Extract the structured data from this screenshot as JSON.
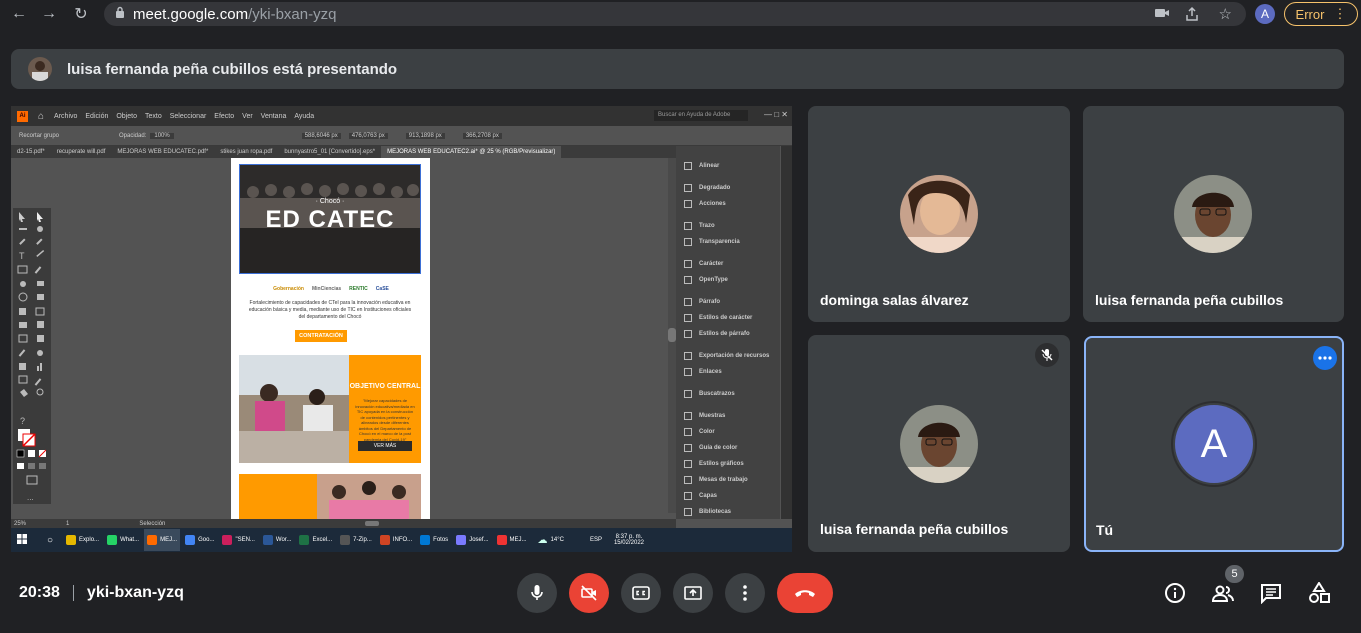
{
  "browser": {
    "url_host": "meet.google.com",
    "url_path": "/yki-bxan-yzq",
    "profile_initial": "A",
    "error_label": "Error"
  },
  "banner": {
    "text": "luisa fernanda peña cubillos está presentando"
  },
  "presentation": {
    "menu": [
      "Archivo",
      "Edición",
      "Objeto",
      "Texto",
      "Seleccionar",
      "Efecto",
      "Ver",
      "Ventana",
      "Ayuda"
    ],
    "search_placeholder": "Buscar en Ayuda de Adobe",
    "control_left": "Recortar grupo",
    "opacity_label": "Opacidad:",
    "opacity_value": "100%",
    "x_value": "588,6046 px",
    "y_value": "476,0763 px",
    "w_value": "913,1898 px",
    "h_value": "366,2708 px",
    "doc_tabs": [
      "d2-15.pdf*",
      "recuperate will.pdf",
      "MEJORAS WEB EDUCATEC.pdf*",
      "stikes juan ropa.pdf",
      "bunnyastro5_01 [Convertido].eps*",
      "MEJORAS WEB EDUCATEC2.ai* @ 25 % (RGB/Previsualizar)"
    ],
    "artboard": {
      "hero_small": "· Chocó ·",
      "hero_logo": "ED CATEC",
      "body_text": "Fortalecimiento de capacidades de CTeI para la innovación educativa en educación básica y media, mediante uso de TIC en Instituciones oficiales del departamento del Chocó",
      "button1": "CONTRATACIÓN",
      "objective_title": "OBJETIVO CENTRAL",
      "objective_text": "\"Mejorar capacidades de innovación educativa/mediada en TIC apoyada en la construcción de contenidos pertinentes y alineados desde diferentes ámbitos del Departamento de Chocó en el marco de la post pandemia del Covid-19\"",
      "button2": "VER MÁS",
      "logos": [
        "Gobernación",
        "MinCiencias",
        "RENTIC",
        "CaSE"
      ]
    },
    "panels": [
      {
        "icon": "align-icon",
        "label": "Alinear"
      },
      {
        "icon": "gradient-icon",
        "label": "Degradado"
      },
      {
        "icon": "actions-icon",
        "label": "Acciones"
      },
      {
        "icon": "stroke-icon",
        "label": "Trazo"
      },
      {
        "icon": "transparency-icon",
        "label": "Transparencia"
      },
      {
        "icon": "character-icon",
        "label": "Carácter"
      },
      {
        "icon": "opentype-icon",
        "label": "OpenType"
      },
      {
        "icon": "paragraph-icon",
        "label": "Párrafo"
      },
      {
        "icon": "char-style-icon",
        "label": "Estilos de carácter"
      },
      {
        "icon": "para-style-icon",
        "label": "Estilos de párrafo"
      },
      {
        "icon": "export-icon",
        "label": "Exportación de recursos"
      },
      {
        "icon": "links-icon",
        "label": "Enlaces"
      },
      {
        "icon": "pathfinder-icon",
        "label": "Buscatrazos"
      },
      {
        "icon": "swatches-icon",
        "label": "Muestras"
      },
      {
        "icon": "color-icon",
        "label": "Color"
      },
      {
        "icon": "color-guide-icon",
        "label": "Guía de color"
      },
      {
        "icon": "graphic-styles-icon",
        "label": "Estilos gráficos"
      },
      {
        "icon": "artboards-icon",
        "label": "Mesas de trabajo"
      },
      {
        "icon": "layers-icon",
        "label": "Capas"
      },
      {
        "icon": "libraries-icon",
        "label": "Bibliotecas"
      }
    ],
    "status_zoom": "25%",
    "status_page": "1",
    "status_tool": "Selección",
    "taskbar": {
      "apps": [
        "Explo...",
        "What...",
        "MEJ...",
        "Goo...",
        "\"SEN...",
        "Wor...",
        "Excel...",
        "7-Zip...",
        "INFO...",
        "Fotos",
        "Josef...",
        "MEJ..."
      ],
      "temperature": "14°C",
      "language": "ESP",
      "time": "8:37 p. m.",
      "date": "15/02/2022"
    }
  },
  "participants": [
    {
      "name": "dominga salas álvarez",
      "muted": false
    },
    {
      "name": "luisa fernanda peña cubillos",
      "muted": false
    },
    {
      "name": "luisa fernanda peña cubillos",
      "muted": true
    },
    {
      "name": "Tú",
      "initial": "A",
      "active": true
    }
  ],
  "bottom": {
    "time": "20:38",
    "meeting_code": "yki-bxan-yzq",
    "people_count": "5"
  },
  "colors": {
    "meet_bg": "#202124",
    "tile_bg": "#3c4043",
    "accent_blue": "#8ab4f8",
    "hangup_red": "#ea4335",
    "avatar_purple": "#5c6bc0",
    "ai_orange": "#ff9a00"
  }
}
